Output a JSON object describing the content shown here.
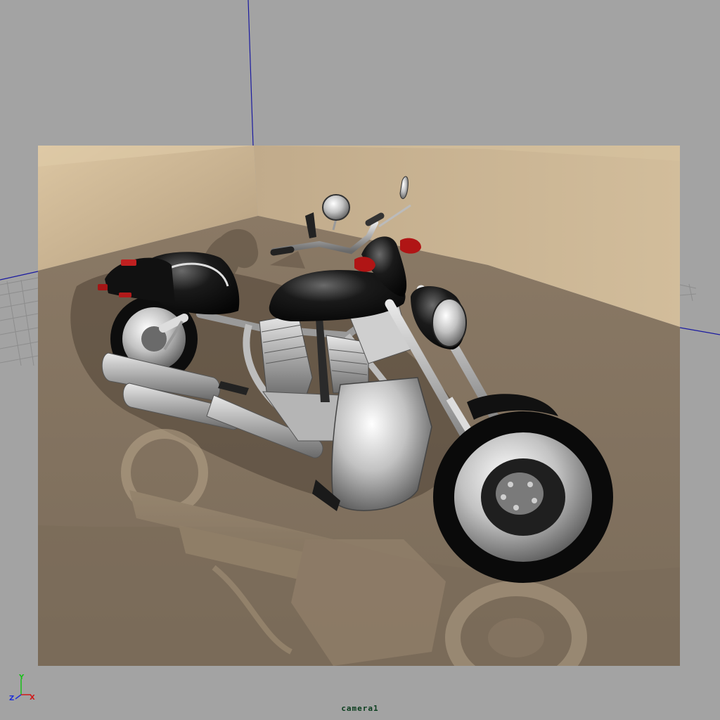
{
  "viewport": {
    "camera_name": "camera1"
  },
  "axis_gizmo": {
    "x_label": "X",
    "y_label": "Y",
    "z_label": "Z",
    "x_color": "#d01818",
    "y_color": "#18c018",
    "z_color": "#2030d8"
  },
  "colors": {
    "viewport_bg": "#a3a3a3",
    "wall": "#c8b394",
    "floor": "#857461",
    "frame_line": "#1a1aa0"
  },
  "scene": {
    "subject": "motorcycle-model"
  }
}
